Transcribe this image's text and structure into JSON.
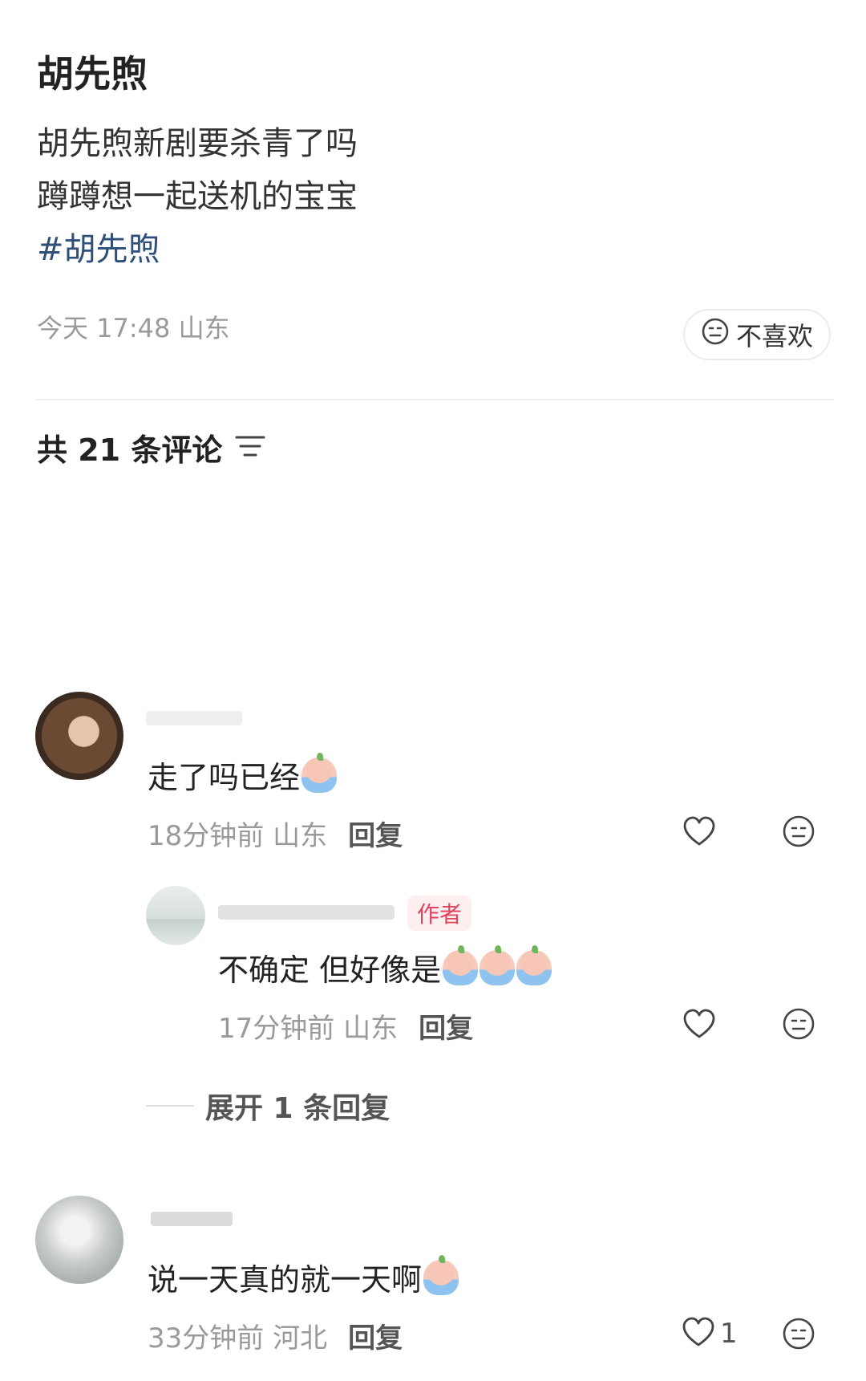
{
  "post": {
    "title": "胡先煦",
    "body_lines": [
      "胡先煦新剧要杀青了吗",
      "蹲蹲想一起送机的宝宝"
    ],
    "hashtag": "#胡先煦",
    "meta": "今天 17:48 山东",
    "dislike_label": "不喜欢"
  },
  "comments_header": "共 21 条评论",
  "comments": [
    {
      "text": "走了吗已经",
      "time": "18分钟前",
      "location": "山东",
      "reply_label": "回复",
      "emoji_count": 1
    },
    {
      "badge": "作者",
      "text": "不确定 但好像是",
      "time": "17分钟前",
      "location": "山东",
      "reply_label": "回复",
      "emoji_count": 3
    },
    {
      "text": "说一天真的就一天啊",
      "time": "33分钟前",
      "location": "河北",
      "reply_label": "回复",
      "like_count": "1",
      "emoji_count": 1
    }
  ],
  "expand_replies": "展开 1 条回复",
  "colors": {
    "hashtag": "#2d4f7a",
    "author_badge": "#e0445c",
    "meta_gray": "#9a9a9a"
  },
  "icons": [
    "dislike-face-icon",
    "sort-icon",
    "heart-icon",
    "neutral-face-icon",
    "crying-emoji-icon"
  ]
}
